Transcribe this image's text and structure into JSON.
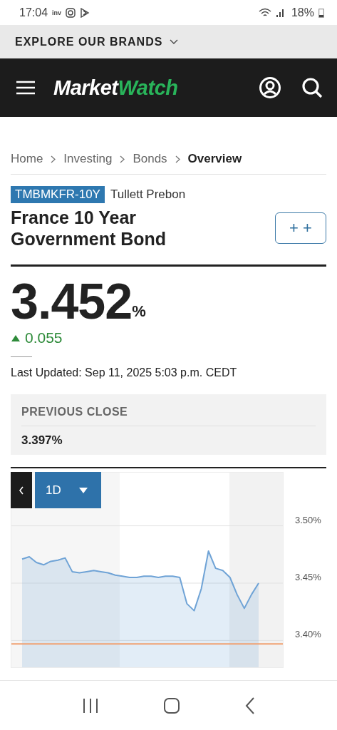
{
  "status_bar": {
    "time": "17:04",
    "notification_text": "inv",
    "battery": "18%"
  },
  "brands_bar": {
    "label": "EXPLORE OUR BRANDS"
  },
  "header": {
    "logo": {
      "part_1": "Market",
      "part_2": "Watch"
    }
  },
  "breadcrumbs": [
    {
      "label": "Home",
      "current": false
    },
    {
      "label": "Investing",
      "current": false
    },
    {
      "label": "Bonds",
      "current": false
    },
    {
      "label": "Overview",
      "current": true
    }
  ],
  "instrument": {
    "ticker": "TMBMKFR-10Y",
    "source": "Tullett Prebon",
    "title": "France 10 Year Government Bond",
    "watch_button": "+ +"
  },
  "quote": {
    "price": "3.452",
    "unit": "%",
    "change": "0.055",
    "positive": true,
    "last_updated": "Last Updated: Sep 11, 2025 5:03 p.m. CEDT"
  },
  "previous_close": {
    "label": "PREVIOUS CLOSE",
    "value": "3.397%"
  },
  "chart": {
    "range": "1D",
    "chart_data": {
      "type": "area",
      "grid": true,
      "ylim": [
        3.376,
        3.547
      ],
      "yticks": [
        {
          "value": 3.5,
          "label": "3.50%"
        },
        {
          "value": 3.45,
          "label": "3.45%"
        },
        {
          "value": 3.4,
          "label": "3.40%"
        }
      ],
      "series": [
        {
          "color": "#6fa3d6",
          "values": [
            3.471,
            3.473,
            3.468,
            3.466,
            3.469,
            3.47,
            3.472,
            3.46,
            3.459,
            3.46,
            3.461,
            3.46,
            3.459,
            3.457,
            3.456,
            3.455,
            3.455,
            3.456,
            3.456,
            3.455,
            3.456,
            3.456,
            3.455,
            3.432,
            3.426,
            3.445,
            3.478,
            3.463,
            3.461,
            3.455,
            3.44,
            3.428,
            3.44,
            3.45
          ]
        }
      ],
      "ref_lines": [
        {
          "axis": "y",
          "value": 3.397,
          "color": "#f0a070"
        }
      ]
    }
  }
}
